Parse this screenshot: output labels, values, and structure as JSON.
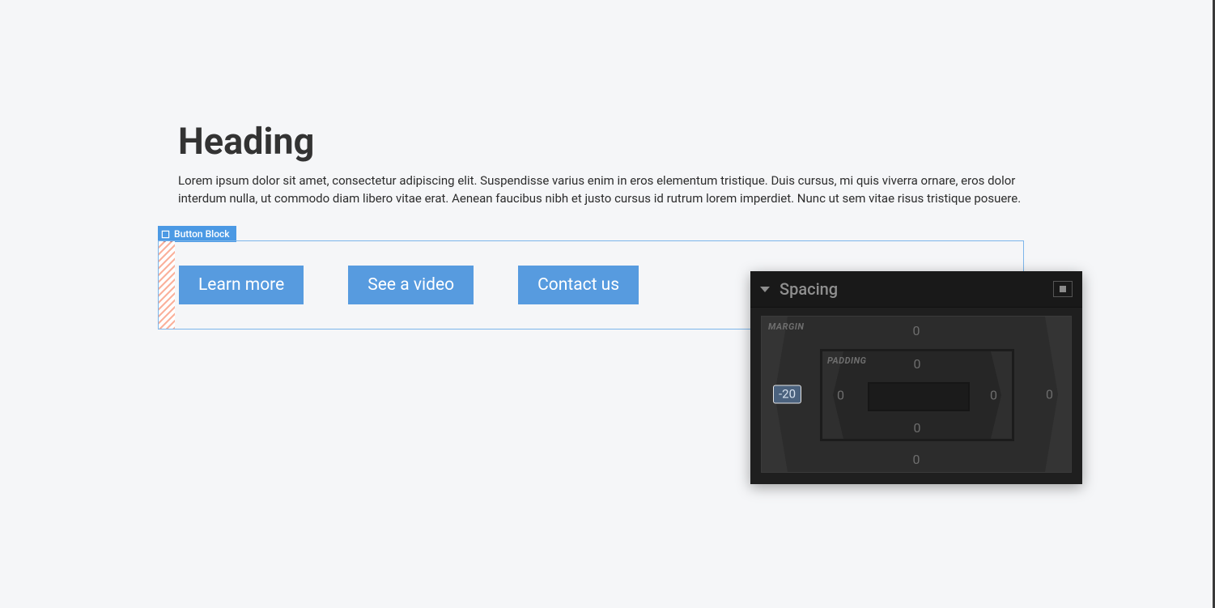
{
  "page": {
    "heading": "Heading",
    "paragraph": "Lorem ipsum dolor sit amet, consectetur adipiscing elit. Suspendisse varius enim in eros elementum tristique. Duis cursus, mi quis viverra ornare, eros dolor interdum nulla, ut commodo diam libero vitae erat. Aenean faucibus nibh et justo cursus id rutrum lorem imperdiet. Nunc ut sem vitae risus tristique posuere."
  },
  "selection": {
    "block_type": "Button Block"
  },
  "buttons": {
    "b1": "Learn more",
    "b2": "See a video",
    "b3": "Contact us"
  },
  "inspector": {
    "section_title": "Spacing",
    "margin_label": "MARGIN",
    "padding_label": "PADDING",
    "margin": {
      "top": "0",
      "right": "0",
      "bottom": "0",
      "left": "-20"
    },
    "padding": {
      "top": "0",
      "right": "0",
      "bottom": "0",
      "left": "0"
    }
  }
}
